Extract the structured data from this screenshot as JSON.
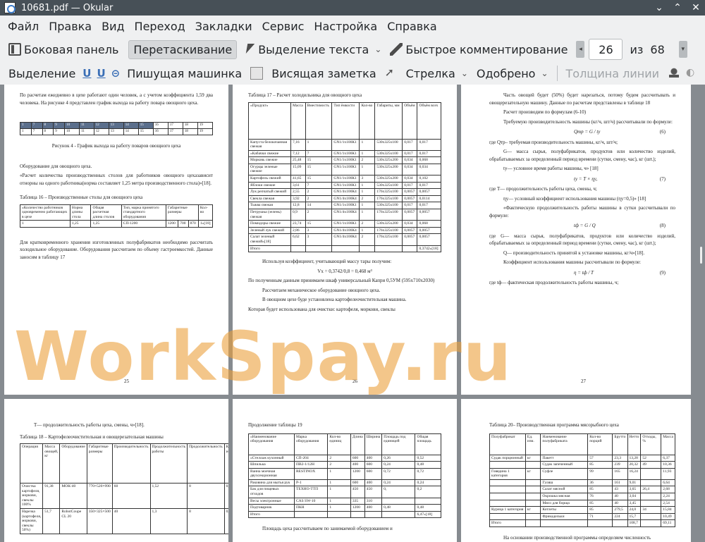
{
  "window": {
    "title": "10681.pdf — Okular"
  },
  "menu": [
    "Файл",
    "Правка",
    "Вид",
    "Переход",
    "Закладки",
    "Сервис",
    "Настройка",
    "Справка"
  ],
  "toolbar1": {
    "sidebar": "Боковая панель",
    "drag": "Перетаскивание",
    "text_select": "Выделение текста",
    "quick_comment": "Быстрое комментирование",
    "page_current": "26",
    "page_of": "из",
    "page_total": "68"
  },
  "toolbar2": {
    "highlight": "Выделение",
    "u1": "U",
    "u2": "U",
    "typewriter": "Пишущая машинка",
    "note": "Висящая заметка",
    "arrow": "Стрелка",
    "approved": "Одобрено",
    "line_width": "Толщина линии"
  },
  "watermark": "WorkSpay.ru",
  "pages": {
    "p25": {
      "para1": "По расчетам ежедневно в цехе работают один человек, а с учетом коэффициента 1,59 два человека. На рисунке 4 представлен график выхода на работу повара овощного цеха.",
      "caption4": "Рисунок 4 - График выхода на работу поваров овощного цеха",
      "para2": "Оборудование для овощного цеха.",
      "para3": "«Расчет количества производственных столов для работников овощного цехазависит отнорны на одного работника(норма составляет 1,25 метра производственного стола)»[18].",
      "table16": "Таблица 16 – Производственные столы для овощного цеха",
      "para4": "Для кратковременного хранения изготовленных полуфабрикатов необходимо рассчитать холодильное оборудование. Оборудования рассчитаем по объему гастроемкостей. Данные заносим в таблицу 17",
      "num": "25"
    },
    "p26": {
      "table17": "Таблица 17 – Расчет холодильника для овощного цеха",
      "rows": [
        "Капуста белокочанная свежая",
        "«Кабачки свежие",
        "Морковь свежие",
        "Огурцы зеленые свежие",
        "Картофель свежий",
        "Яблоки свежие",
        "Лук репчатый свежий",
        "Свекла свежая",
        "Тыква свежая",
        "Петрушка (зелень) свежая",
        "Помидоры свежие",
        "Зеленый лук свежий",
        "Салат зеленый свежий»[18]",
        "Итого"
      ],
      "para1": "Используя коэффициент, учитывающий массу тары получим:",
      "formula": "Vх = 0,3742/0,8 = 0,468 м³",
      "para2": "По полученным данным принимаем шкаф универсальный Капри 0,5УМ (595х710х2030)",
      "para3": "Рассчитаем механическое оборудование овощного цеха.",
      "para4": "В овощном цехе буде установлена картофелеочистительная машина.",
      "para5": "Которая будет использована для очистки: картофеля, моркови, свеклы",
      "num": "26"
    },
    "p27": {
      "para1": "Часть овощей будет (50%) будет нарезаться, потому будем рассчитывать и овощерезательную машину. Данные по расчетам представлены в таблице 18",
      "para2": "Расчет производим по формулам (6-10)",
      "para3": "Требуемую производительность машины (кг/ч, шт/ч) рассчитывали по формуле:",
      "f6": "Qтр = G / ty",
      "n6": "(6)",
      "para4": "где Qтр– требуемая производительность машины, кг/ч, шт/ч;",
      "para5": "G— масса сырья, полуфабрикатов, продуктов или количество изделий, обрабатываемых за определенный период времени (сутки, смену, час), кг (шт.);",
      "para6": "ty— условное время работы машины, ч» [18]",
      "f7": "ty = T × ηy,",
      "n7": "(7)",
      "para7": "где T— продолжительность работы цеха, смены, ч;",
      "para8": "ηy— условный коэффициент использования машины (ηy=0,5)» [18]",
      "para9": "«Фактическую продолжительность работы машины в сутки рассчитывали по формуле:",
      "f8": "tф = G / Q",
      "n8": "(8)",
      "para10": "где G— масса сырья, полуфабрикатов, продуктов или количество изделий, обрабатываемых за определенный период времени (сутки, смену, час), кг (шт.);",
      "para11": "Q— производительность принятой к установке машины, кг/ч»[18].",
      "para12": "Коэффициент использования машины рассчитывали по формуле:",
      "f9": "η = tф / T",
      "n9": "(9)",
      "para13": "где tф— фактическая продолжительность работы машины, ч;",
      "num": "27"
    },
    "p28": {
      "para1": "T— продолжительность работы цеха, смены, ч»[18].",
      "table18": "Таблица 18 – Картофелеочистительная и овощерезательная машины"
    },
    "p29": {
      "caption": "Продолжение таблицы 19",
      "rows": [
        "«Стеллаж кухонный",
        "Шпилька",
        "Ванна моечная двухсекционная",
        "Раковина для мытья рук",
        "Бак для пищевых отходов",
        "Весы электронные",
        "Подтоварник",
        "Итого"
      ],
      "para1": "Площадь цеха рассчитываем по занимаемой оборудованием и"
    },
    "p30": {
      "table20": "Таблица 20– Производственная программа мясорыбного цеха",
      "rows": [
        "Судак порционный",
        "Говядина 1 категория",
        "Курица 1 категория",
        "Итого"
      ],
      "para1": "На основании производственной программы определяем численность"
    }
  }
}
